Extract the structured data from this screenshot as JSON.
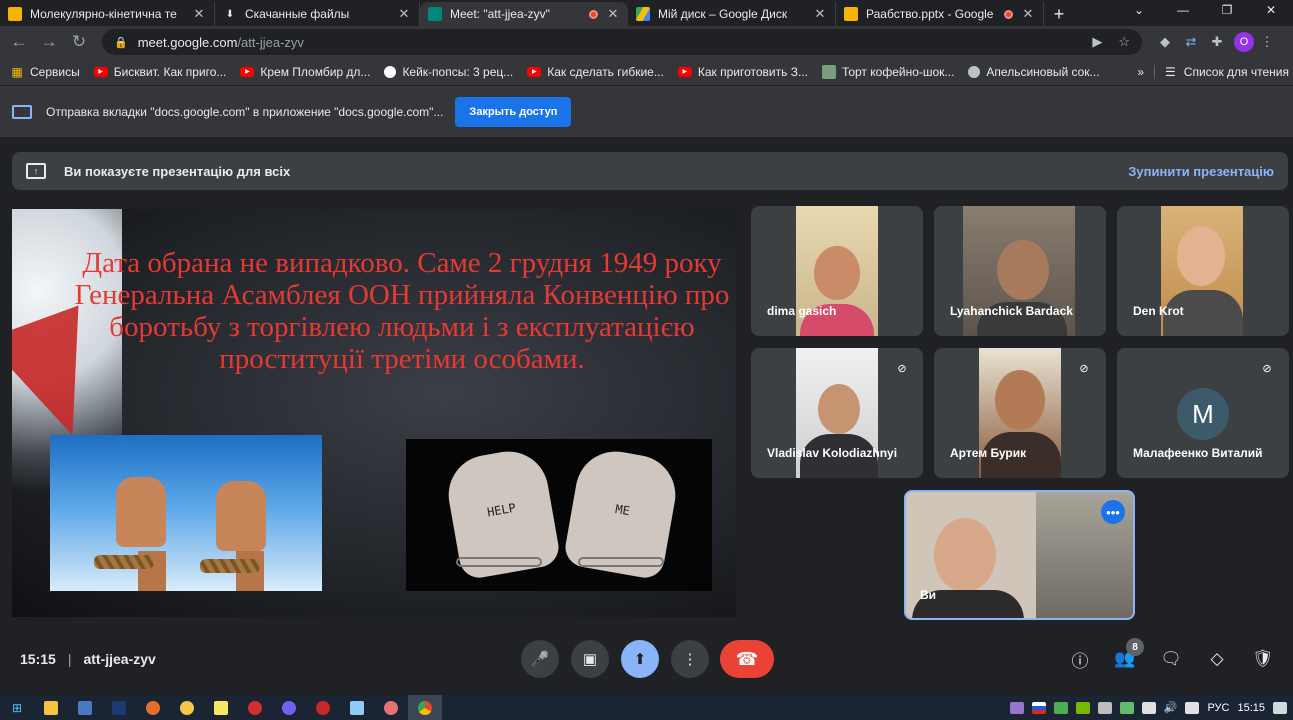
{
  "browser": {
    "tabs": [
      {
        "title": "Молекулярно-кінетична те",
        "icon": "slides-icon",
        "color": "#f4b400",
        "active": false,
        "recording": false
      },
      {
        "title": "Скачанные файлы",
        "icon": "download-icon",
        "color": "#e8eaed",
        "active": false,
        "recording": false
      },
      {
        "title": "Meet: \"att-jjea-zyv\"",
        "icon": "meet-icon",
        "color": "#00897b",
        "active": true,
        "recording": true
      },
      {
        "title": "Мій диск – Google Диск",
        "icon": "drive-icon",
        "color": "#34a853",
        "active": false,
        "recording": false
      },
      {
        "title": "Раабство.pptx - Google",
        "icon": "slides-icon",
        "color": "#f4b400",
        "active": false,
        "recording": true
      }
    ],
    "url_host": "meet.google.com",
    "url_path": "/att-jjea-zyv",
    "bookmarks": [
      {
        "label": "Сервисы",
        "icon": "apps-grid-icon"
      },
      {
        "label": "Бисквит. Как приго...",
        "icon": "youtube-icon"
      },
      {
        "label": "Крем Пломбир дл...",
        "icon": "youtube-icon"
      },
      {
        "label": "Кейк-попсы: 3 рец...",
        "icon": "cookie-icon"
      },
      {
        "label": "Как сделать гибкие...",
        "icon": "youtube-icon"
      },
      {
        "label": "Как приготовить З...",
        "icon": "youtube-icon"
      },
      {
        "label": "Торт кофейно-шок...",
        "icon": "image-icon"
      },
      {
        "label": "Апельсиновый сок...",
        "icon": "globe-icon"
      }
    ],
    "bookmarks_more": "»",
    "reading_list": "Список для чтения",
    "infobar_text": "Отправка вкладки \"docs.google.com\" в приложение \"docs.google.com\"...",
    "infobar_button": "Закрыть доступ",
    "profile_initial": "O"
  },
  "meet": {
    "banner_text": "Ви показуєте презентацію для всіх",
    "banner_stop": "Зупинити презентацію",
    "slide_text": "Дата обрана не випадково. Саме 2 грудня 1949 року Генеральна Асамблея ООН прийняла Конвенцію про боротьбу з торгівлею людьми і з експлуатацією проституції третіми особами.",
    "slide_hand_left": "HELP",
    "slide_hand_right": "ME",
    "participants": [
      {
        "name": "dima gasich"
      },
      {
        "name": "Lyahanchick Bardack"
      },
      {
        "name": "Den Krot"
      },
      {
        "name": "Vladislav Kolodiazhnyi"
      },
      {
        "name": "Артем Бурик"
      },
      {
        "name": "Малафеенко Виталий",
        "initial": "M"
      }
    ],
    "self_name": "Ви",
    "time": "15:15",
    "meeting_code": "att-jjea-zyv",
    "people_count": "8"
  },
  "taskbar": {
    "lang": "РУС",
    "time": "15:15"
  },
  "colors": {
    "accent": "#8ab4f8",
    "leave": "#ea4335",
    "slide_text": "#e53935"
  }
}
